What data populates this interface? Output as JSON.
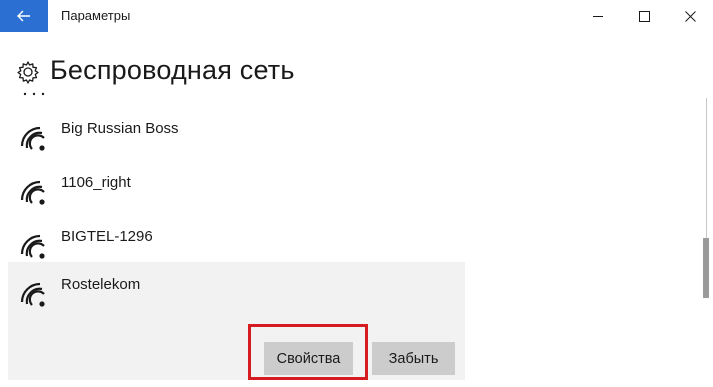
{
  "window": {
    "title": "Параметры"
  },
  "page": {
    "title": "Беспроводная сеть"
  },
  "networks": [
    {
      "name": "Big Russian Boss"
    },
    {
      "name": "1106_right"
    },
    {
      "name": "BIGTEL-1296"
    },
    {
      "name": "Rostelekom"
    }
  ],
  "selected_network": {
    "properties_label": "Свойства",
    "forget_label": "Забыть"
  },
  "colors": {
    "accent": "#2b6fd3",
    "highlight": "#d71a20"
  },
  "icons": [
    "back-arrow-icon",
    "minimize-icon",
    "maximize-icon",
    "close-icon",
    "gear-icon",
    "wifi-signal-icon"
  ]
}
